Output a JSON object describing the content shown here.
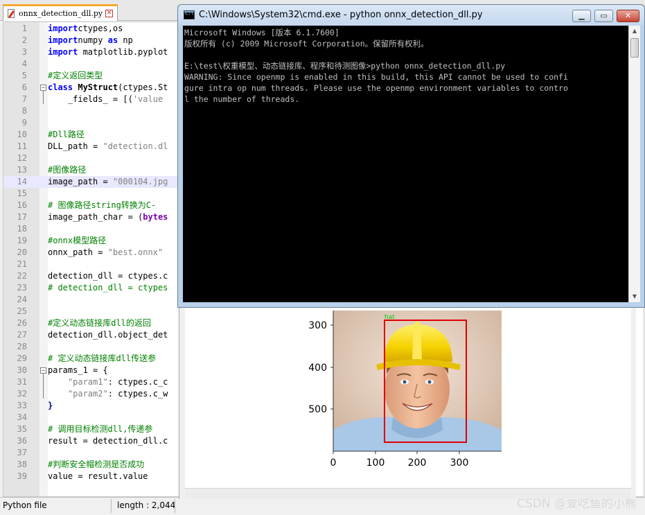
{
  "editor": {
    "tab_label": "onnx_detection_dll.py",
    "tab_close": "✕",
    "lines": [
      {
        "n": "1",
        "parts": [
          [
            "kw",
            "import"
          ],
          [
            "",
            "ctypes,os"
          ]
        ]
      },
      {
        "n": "2",
        "parts": [
          [
            "kw",
            "import"
          ],
          [
            "",
            "numpy "
          ],
          [
            "kw",
            "as"
          ],
          [
            "",
            " np"
          ]
        ]
      },
      {
        "n": "3",
        "parts": [
          [
            "kw",
            "import"
          ],
          [
            "",
            " matplotlib.pyplot"
          ]
        ]
      },
      {
        "n": "4",
        "parts": []
      },
      {
        "n": "5",
        "parts": [
          [
            "cm",
            "#定义返回类型"
          ]
        ]
      },
      {
        "n": "6",
        "parts": [
          [
            "kw",
            "class"
          ],
          [
            "",
            " "
          ],
          [
            "b",
            "MyStruct"
          ],
          [
            "",
            "(ctypes.St"
          ]
        ]
      },
      {
        "n": "7",
        "parts": [
          [
            "",
            "    _fields_ = [("
          ],
          [
            "st",
            "'value"
          ]
        ]
      },
      {
        "n": "8",
        "parts": []
      },
      {
        "n": "9",
        "parts": []
      },
      {
        "n": "10",
        "parts": [
          [
            "cm",
            "#Dll路径"
          ]
        ]
      },
      {
        "n": "11",
        "parts": [
          [
            "",
            "DLL_path = "
          ],
          [
            "st",
            "\"detection.dl"
          ]
        ]
      },
      {
        "n": "12",
        "parts": []
      },
      {
        "n": "13",
        "parts": [
          [
            "cm",
            "#图像路径"
          ]
        ]
      },
      {
        "n": "14",
        "parts": [
          [
            "",
            "image_path = "
          ],
          [
            "st",
            "\"000104.jpg"
          ]
        ]
      },
      {
        "n": "15",
        "parts": []
      },
      {
        "n": "16",
        "parts": [
          [
            "cm",
            "# 图像路径string转换为C-"
          ]
        ]
      },
      {
        "n": "17",
        "parts": [
          [
            "",
            "image_path_char = ("
          ],
          [
            "kw2",
            "bytes"
          ]
        ]
      },
      {
        "n": "18",
        "parts": []
      },
      {
        "n": "19",
        "parts": [
          [
            "cm",
            "#onnx模型路径"
          ]
        ]
      },
      {
        "n": "20",
        "parts": [
          [
            "",
            "onnx_path = "
          ],
          [
            "st",
            "\"best.onnx\""
          ]
        ]
      },
      {
        "n": "21",
        "parts": []
      },
      {
        "n": "22",
        "parts": [
          [
            "",
            "detection_dll = ctypes.c"
          ]
        ]
      },
      {
        "n": "23",
        "parts": [
          [
            "cm",
            "# detection_dll = ctypes"
          ]
        ]
      },
      {
        "n": "24",
        "parts": []
      },
      {
        "n": "25",
        "parts": []
      },
      {
        "n": "26",
        "parts": [
          [
            "cm",
            "#定义动态链接库dll的返回"
          ]
        ]
      },
      {
        "n": "27",
        "parts": [
          [
            "",
            "detection_dll.object_det"
          ]
        ]
      },
      {
        "n": "28",
        "parts": []
      },
      {
        "n": "29",
        "parts": [
          [
            "cm",
            "# 定义动态链接库dll传送参"
          ]
        ]
      },
      {
        "n": "30",
        "parts": [
          [
            "",
            "params_1 = {"
          ]
        ]
      },
      {
        "n": "31",
        "parts": [
          [
            "",
            "    "
          ],
          [
            "st",
            "\"param1\""
          ],
          [
            "",
            ": ctypes.c_c"
          ]
        ]
      },
      {
        "n": "32",
        "parts": [
          [
            "",
            "    "
          ],
          [
            "st",
            "\"param2\""
          ],
          [
            "",
            ": ctypes.c_w"
          ]
        ]
      },
      {
        "n": "33",
        "parts": [
          [
            "op",
            "}"
          ]
        ]
      },
      {
        "n": "34",
        "parts": []
      },
      {
        "n": "35",
        "parts": [
          [
            "cm",
            "# 调用目标检测dll,传递参"
          ]
        ]
      },
      {
        "n": "36",
        "parts": [
          [
            "",
            "result = detection_dll.c"
          ]
        ]
      },
      {
        "n": "37",
        "parts": []
      },
      {
        "n": "38",
        "parts": [
          [
            "cm",
            "#判断安全帽检测是否成功"
          ]
        ]
      },
      {
        "n": "39",
        "parts": [
          [
            "",
            "value = result.value"
          ]
        ]
      }
    ]
  },
  "status": {
    "file_type": "Python file",
    "length": "length : 2,044"
  },
  "watermark": "CSDN @爱吃鱼的小熊",
  "cmd": {
    "title": "C:\\Windows\\System32\\cmd.exe - python  onnx_detection_dll.py",
    "btn_min": "▁",
    "btn_max": "▭",
    "btn_close": "✕",
    "lines": [
      "Microsoft Windows [版本 6.1.7600]",
      "版权所有 (c) 2009 Microsoft Corporation。保留所有权利。",
      "",
      "E:\\test\\权重模型、动态链接库、程序和待测图像>python onnx_detection_dll.py",
      "WARNING: Since openmp is enabled in this build, this API cannot be used to confi",
      "gure intra op num threads. Please use the openmp environment variables to contro",
      "l the number of threads."
    ]
  },
  "plot": {
    "y_ticks": [
      "300",
      "400",
      "500"
    ],
    "x_ticks": [
      "0",
      "100",
      "200",
      "300"
    ],
    "box_label": "hat",
    "box_color": "#e00000",
    "label_color": "#00cc00"
  }
}
